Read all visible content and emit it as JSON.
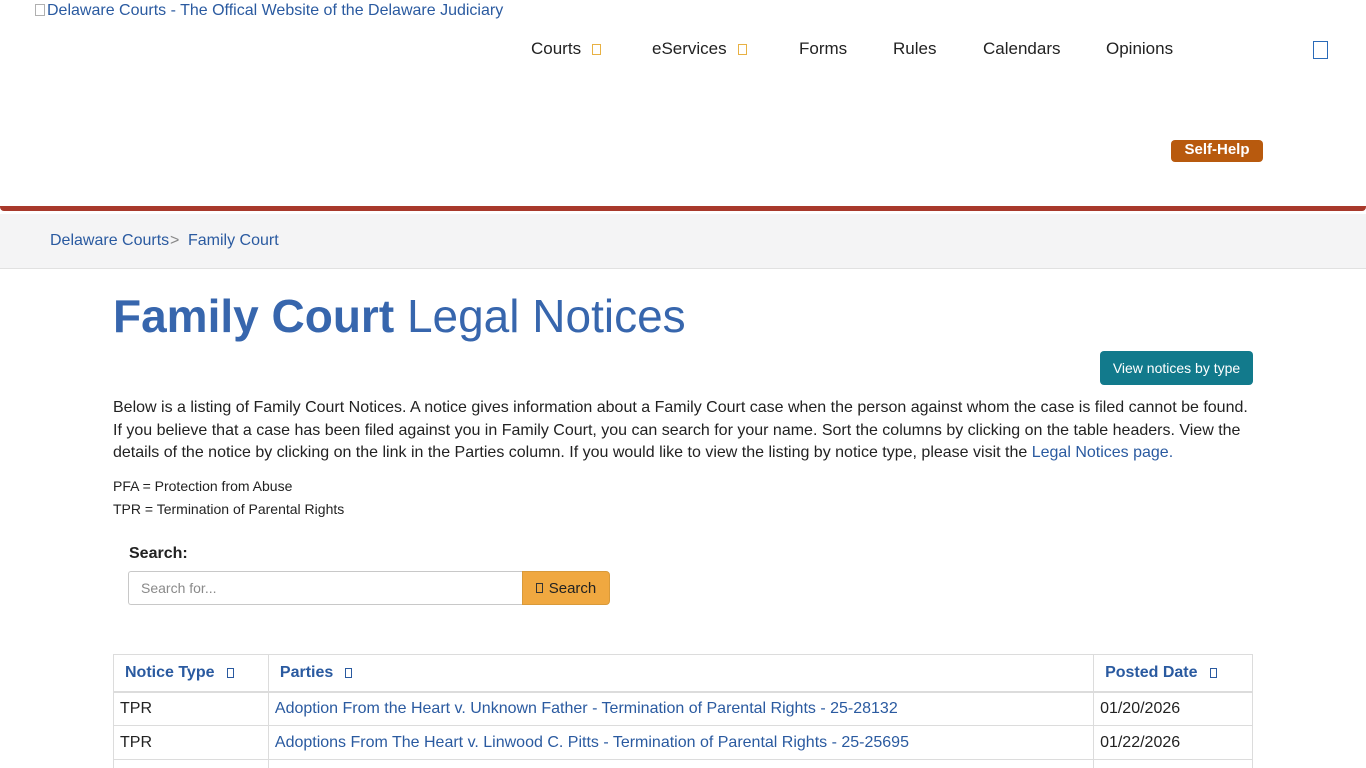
{
  "header": {
    "logo_alt": "Delaware Courts - The Offical Website of the Delaware Judiciary",
    "nav": [
      {
        "label": "Courts",
        "has_dropdown": true
      },
      {
        "label": "eServices",
        "has_dropdown": true
      },
      {
        "label": "Forms",
        "has_dropdown": false
      },
      {
        "label": "Rules",
        "has_dropdown": false
      },
      {
        "label": "Calendars",
        "has_dropdown": false
      },
      {
        "label": "Opinions",
        "has_dropdown": false
      }
    ],
    "search_icon": "search-icon",
    "self_help": "Self-Help"
  },
  "breadcrumb": {
    "items": [
      "Delaware Courts",
      "Family Court"
    ],
    "separator": ">"
  },
  "page": {
    "title_strong": "Family Court",
    "title_rest": "Legal Notices",
    "view_button": "View notices by type",
    "intro_text": "Below is a listing of Family Court Notices. A notice gives information about a Family Court case when the person against whom the case is filed cannot be found. If you believe that a case has been filed against you in Family Court, you can search for your name. Sort the columns by clicking on the table headers. View the details of the notice by clicking on the link in the Parties column. If you would like to view the listing by notice type, please visit the",
    "intro_link": "Legal Notices page.",
    "abbreviations": [
      "PFA = Protection from Abuse",
      "TPR = Termination of Parental Rights"
    ]
  },
  "search": {
    "label": "Search:",
    "placeholder": "Search for...",
    "button": "Search"
  },
  "table": {
    "columns": [
      "Notice Type",
      "Parties",
      "Posted Date"
    ],
    "rows": [
      {
        "type": "TPR",
        "parties": "Adoption From the Heart v. Unknown Father - Termination of Parental Rights - 25-28132",
        "date": "01/20/2026"
      },
      {
        "type": "TPR",
        "parties": "Adoptions From The Heart v. Linwood C. Pitts - Termination of Parental Rights - 25-25695",
        "date": "01/22/2026"
      }
    ]
  },
  "colors": {
    "title_blue": "#3766ad",
    "link_blue": "#2a5aa0",
    "accent_red": "#a8392b",
    "self_help_orange": "#b85a0e",
    "teal_button": "#127a8c",
    "search_button": "#f0a840",
    "dropdown_caret": "#e8b143"
  }
}
